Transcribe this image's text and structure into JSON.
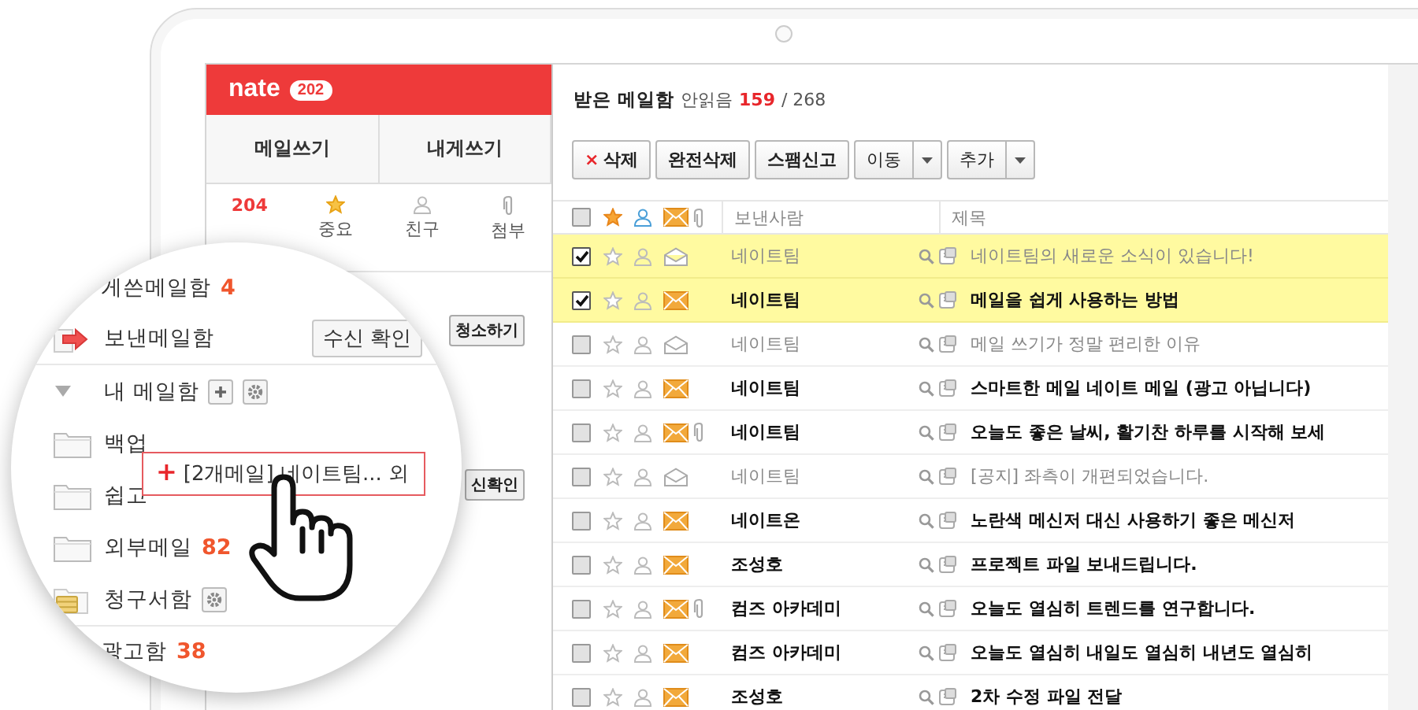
{
  "logo": {
    "text": "nate",
    "badge": "202"
  },
  "compose_buttons": [
    "메일쓰기",
    "내게쓰기"
  ],
  "filters": [
    {
      "kind": "count",
      "value": "204"
    },
    {
      "kind": "star",
      "label": "중요"
    },
    {
      "kind": "person",
      "label": "친구"
    },
    {
      "kind": "clip",
      "label": "첨부"
    }
  ],
  "sidebar_buttons": [
    "청소하기",
    "신확인"
  ],
  "magnifier": {
    "folders": [
      {
        "kind": "plain",
        "label": "게쓴메일함",
        "count": "4"
      },
      {
        "kind": "sent",
        "label": "보낸메일함",
        "button": "수신 확인"
      },
      {
        "kind": "group",
        "label": "내 메일함",
        "expanded": true
      },
      {
        "kind": "folder",
        "label": "백업"
      },
      {
        "kind": "folder",
        "label": "쉽고"
      },
      {
        "kind": "folder",
        "label": "외부메일",
        "count": "82"
      },
      {
        "kind": "bill",
        "label": "청구서함"
      },
      {
        "kind": "plain",
        "label": "광고함",
        "count": "38"
      }
    ],
    "drag_label": {
      "plus": "+",
      "text": "[2개메일] 네이트팀... 외"
    }
  },
  "mailbox": {
    "title": "받은 메일함",
    "unread_label": "안읽음",
    "unread": "159",
    "total": "/ 268"
  },
  "toolbar": [
    {
      "kind": "delete",
      "icon": "×",
      "label": "삭제"
    },
    {
      "kind": "plain",
      "label": "완전삭제"
    },
    {
      "kind": "plain",
      "label": "스팸신고"
    },
    {
      "kind": "dropdown",
      "label": "이동"
    },
    {
      "kind": "dropdown",
      "label": "추가"
    }
  ],
  "select_all": {
    "checked": false
  },
  "columns": [
    "보낸사람",
    "제목"
  ],
  "messages": [
    {
      "checked": true,
      "read": true,
      "attachment": false,
      "sender": "네이트팀",
      "subject": "네이트팀의 새로운 소식이 있습니다!"
    },
    {
      "checked": true,
      "read": false,
      "attachment": false,
      "sender": "네이트팀",
      "subject": "메일을 쉽게 사용하는 방법"
    },
    {
      "checked": false,
      "read": true,
      "attachment": false,
      "sender": "네이트팀",
      "subject": "메일 쓰기가 정말 편리한 이유"
    },
    {
      "checked": false,
      "read": false,
      "attachment": false,
      "sender": "네이트팀",
      "subject": "스마트한 메일 네이트 메일 (광고 아닙니다)"
    },
    {
      "checked": false,
      "read": false,
      "attachment": true,
      "sender": "네이트팀",
      "subject": "오늘도 좋은 날씨, 활기찬 하루를 시작해 보세"
    },
    {
      "checked": false,
      "read": true,
      "attachment": false,
      "sender": "네이트팀",
      "subject": "[공지] 좌측이 개편되었습니다."
    },
    {
      "checked": false,
      "read": false,
      "attachment": false,
      "sender": "네이트온",
      "subject": "노란색 메신저 대신 사용하기 좋은 메신저"
    },
    {
      "checked": false,
      "read": false,
      "attachment": false,
      "sender": "조성호",
      "subject": "프로젝트 파일 보내드립니다."
    },
    {
      "checked": false,
      "read": false,
      "attachment": true,
      "sender": "컴즈 아카데미",
      "subject": "오늘도 열심히 트렌드를 연구합니다."
    },
    {
      "checked": false,
      "read": false,
      "attachment": false,
      "sender": "컴즈 아카데미",
      "subject": "오늘도 열심히 내일도 열심히 내년도 열심히"
    },
    {
      "checked": false,
      "read": false,
      "attachment": false,
      "sender": "조성호",
      "subject": "2차 수정 파일 전달"
    }
  ]
}
